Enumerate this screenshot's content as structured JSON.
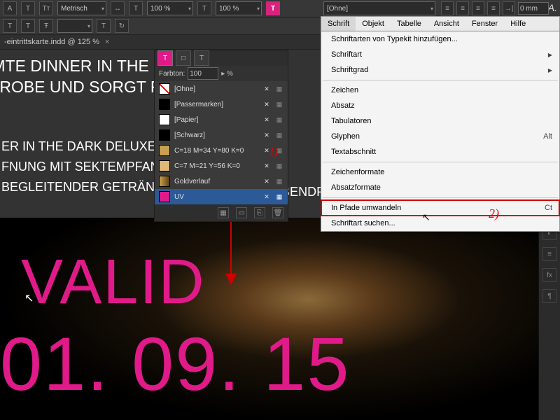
{
  "toolbar": {
    "kerning_mode": "Metrisch",
    "hscale": "100 %",
    "vscale": "100 %",
    "tint_label": "Farbton:",
    "tint_value": "100",
    "char_style": "[Ohne]",
    "inset": "0 mm"
  },
  "document": {
    "tab_title": "-eintrittskarte.indd @ 125 %"
  },
  "artwork": {
    "line1": "IMTE DINNER IN THE DARK S",
    "line2": "PROBE UND SORGT FÜR EINE",
    "bullets": [
      "ER IN THE DARK DELUXE",
      "FNUNG MIT SEKTEMPFANG",
      "BEGLEITENDER GETRÄNKE"
    ],
    "bullet_right": "MUSIKALISCHES ABENDPROGRA",
    "valid": "VALID",
    "date": "01. 09. 15"
  },
  "swatch_panel": {
    "tint_label": "Farbton:",
    "tint_value": "100",
    "rows": [
      {
        "name": "[Ohne]",
        "color": "#ffffff",
        "none": true
      },
      {
        "name": "[Passermarken]",
        "color": "#000000"
      },
      {
        "name": "[Papier]",
        "color": "#ffffff"
      },
      {
        "name": "[Schwarz]",
        "color": "#000000"
      },
      {
        "name": "C=18 M=34 Y=80 K=0",
        "color": "#c9a050"
      },
      {
        "name": "C=7 M=21 Y=56 K=0",
        "color": "#dfb878"
      },
      {
        "name": "Goldverlauf",
        "color": "grad"
      },
      {
        "name": "UV",
        "color": "#e11a8a",
        "selected": true
      }
    ]
  },
  "annotations": {
    "a1": "1)",
    "a2": "2)"
  },
  "menubar": [
    "Schrift",
    "Objekt",
    "Tabelle",
    "Ansicht",
    "Fenster",
    "Hilfe"
  ],
  "menu": {
    "items": [
      {
        "label": "Schriftarten von Typekit hinzufügen..."
      },
      {
        "label": "Schriftart",
        "sub": true
      },
      {
        "label": "Schriftgrad",
        "sub": true
      },
      {
        "sep": true
      },
      {
        "label": "Zeichen"
      },
      {
        "label": "Absatz"
      },
      {
        "label": "Tabulatoren"
      },
      {
        "label": "Glyphen",
        "shortcut": "Alt"
      },
      {
        "label": "Textabschnitt"
      },
      {
        "sep": true
      },
      {
        "label": "Zeichenformate"
      },
      {
        "label": "Absatzformate"
      },
      {
        "sep": true
      },
      {
        "label": "In Pfade umwandeln",
        "shortcut": "Ct",
        "boxed": true
      },
      {
        "label": "Schriftart suchen..."
      }
    ]
  }
}
